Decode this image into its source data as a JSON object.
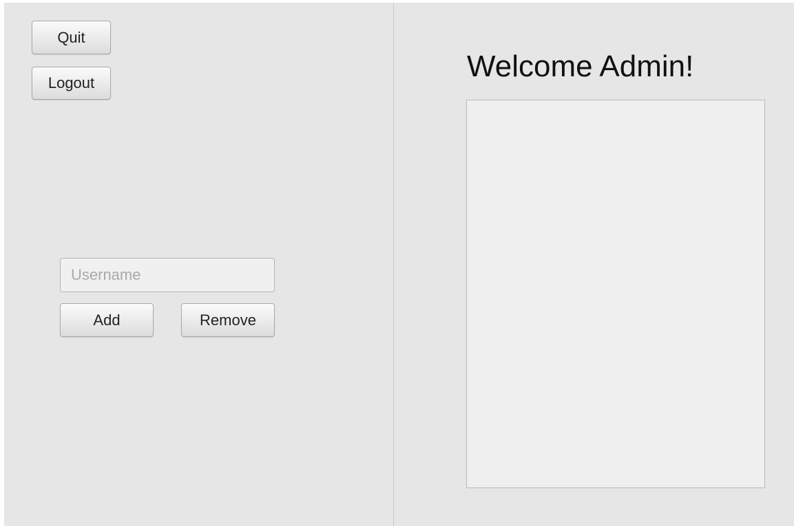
{
  "left_panel": {
    "quit_label": "Quit",
    "logout_label": "Logout",
    "username_placeholder": "Username",
    "username_value": "",
    "add_label": "Add",
    "remove_label": "Remove"
  },
  "right_panel": {
    "welcome_text": "Welcome Admin!",
    "user_list_items": []
  },
  "colors": {
    "background": "#e6e6e6",
    "list_background": "#efefef",
    "divider": "#c8c8c8"
  }
}
